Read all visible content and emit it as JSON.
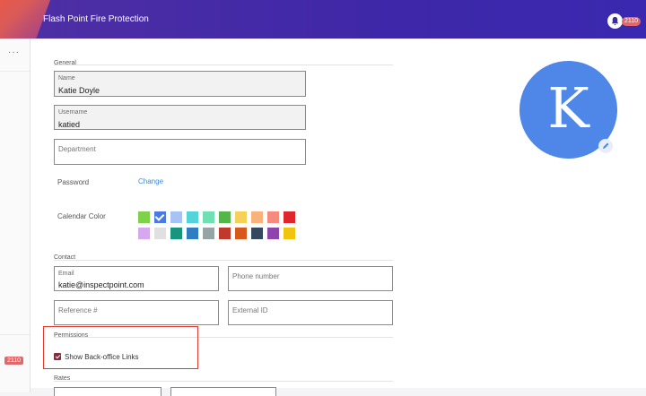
{
  "app": {
    "title": "Flash Point Fire Protection",
    "notification_count": "2110"
  },
  "sidebar": {
    "more_label": "···",
    "badge": "2110"
  },
  "sections": {
    "general": "General",
    "contact": "Contact",
    "permissions": "Permissions",
    "rates": "Rates"
  },
  "fields": {
    "name": {
      "label": "Name",
      "value": "Katie Doyle"
    },
    "username": {
      "label": "Username",
      "value": "katied"
    },
    "department": {
      "placeholder": "Department"
    },
    "email": {
      "label": "Email",
      "value": "katie@inspectpoint.com"
    },
    "phone": {
      "placeholder": "Phone number"
    },
    "reference": {
      "placeholder": "Reference #"
    },
    "external_id": {
      "placeholder": "External ID"
    }
  },
  "password": {
    "label": "Password",
    "action": "Change"
  },
  "calendar": {
    "label": "Calendar Color",
    "selected": "#4a7be3",
    "colors_row1": [
      "#7fd14a",
      "#4a7be3",
      "#a8c3f3",
      "#52d4d9",
      "#6ee0b4",
      "#56b54a",
      "#f5d15a",
      "#f9b27a",
      "#f58a7e",
      "#e0262d"
    ],
    "colors_row2": [
      "#d6a8f0",
      "#e0e0e0",
      "#17957e",
      "#2f7ec1",
      "#95a5a6",
      "#c0392b",
      "#d8581a",
      "#34495e",
      "#8e44ad",
      "#f1c40f"
    ]
  },
  "avatar": {
    "initial": "K",
    "color": "#4f87e8"
  },
  "permissions": {
    "show_backoffice_label": "Show Back-office Links",
    "checked": true
  }
}
